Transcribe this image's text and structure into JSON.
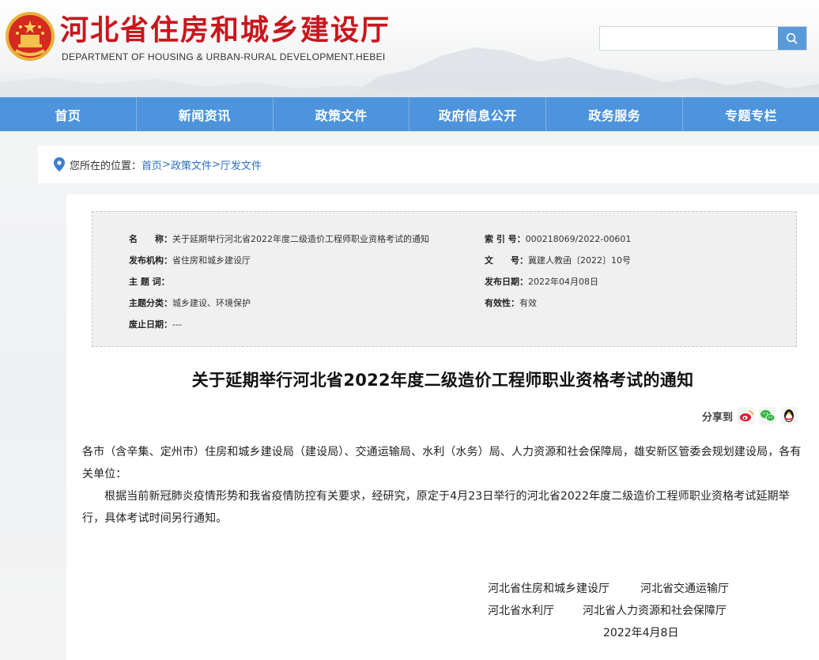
{
  "header": {
    "title": "河北省住房和城乡建设厅",
    "subtitle": "DEPARTMENT OF HOUSING & URBAN-RURAL DEVELOPMENT.HEBEI",
    "emblem_icon": "national-emblem",
    "search": {
      "placeholder": "",
      "button_icon": "search-icon"
    }
  },
  "nav": {
    "items": [
      {
        "label": "首页"
      },
      {
        "label": "新闻资讯"
      },
      {
        "label": "政策文件"
      },
      {
        "label": "政府信息公开"
      },
      {
        "label": "政务服务"
      },
      {
        "label": "专题专栏"
      }
    ],
    "color": "#4d94dc"
  },
  "breadcrumb": {
    "prefix": "您所在的位置：",
    "items": [
      "首页",
      "政策文件",
      "厅发文件"
    ],
    "separator": ">",
    "icon": "location-pin-icon"
  },
  "meta": {
    "name_label": "名　　称：",
    "name_value": "关于延期举行河北省2022年度二级造价工程师职业资格考试的通知",
    "publisher_label": "发布机构：",
    "publisher_value": "省住房和城乡建设厅",
    "keywords_label": "主 题 词：",
    "keywords_value": "",
    "category_label": "主题分类：",
    "category_value": "城乡建设、环境保护",
    "abolish_label": "废止日期：",
    "abolish_value": "---",
    "index_label": "索 引 号：",
    "index_value": "000218069/2022-00601",
    "docno_label": "文　　号：",
    "docno_value": "冀建人教函〔2022〕10号",
    "date_label": "发布日期：",
    "date_value": "2022年04月08日",
    "validity_label": "有效性：",
    "validity_value": "有效"
  },
  "article": {
    "title": "关于延期举行河北省2022年度二级造价工程师职业资格考试的通知",
    "share_label": "分享到",
    "share_icons": [
      "weibo-icon",
      "wechat-icon",
      "qq-icon"
    ],
    "greeting": "各市（含辛集、定州市）住房和城乡建设局（建设局）、交通运输局、水利（水务）局、人力资源和社会保障局，雄安新区管委会规划建设局，各有关单位：",
    "paragraph": "根据当前新冠肺炎疫情形势和我省疫情防控有关要求，经研究，原定于4月23日举行的河北省2022年度二级造价工程师职业资格考试延期举行，具体考试时间另行通知。",
    "signatures": [
      "河北省住房和城乡建设厅",
      "河北省交通运输厅",
      "河北省水利厅",
      "河北省人力资源和社会保障厅"
    ],
    "date": "2022年4月8日"
  }
}
